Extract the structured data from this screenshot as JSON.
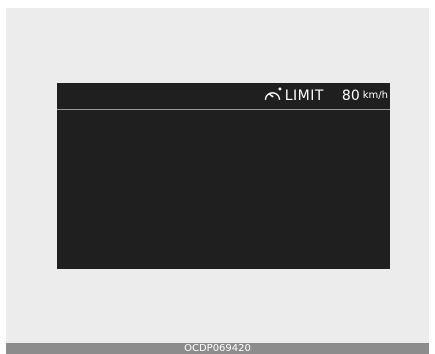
{
  "cluster": {
    "icon": "speed-limiter-icon",
    "limit_label": "LIMIT",
    "speed_value": "80",
    "speed_unit": "km/h"
  },
  "footer": {
    "code": "OCDP069420"
  },
  "colors": {
    "screen_bg": "#1f1f1f",
    "frame_bg": "#ececec",
    "footer_bg": "#8c8c8c",
    "text": "#ffffff"
  }
}
